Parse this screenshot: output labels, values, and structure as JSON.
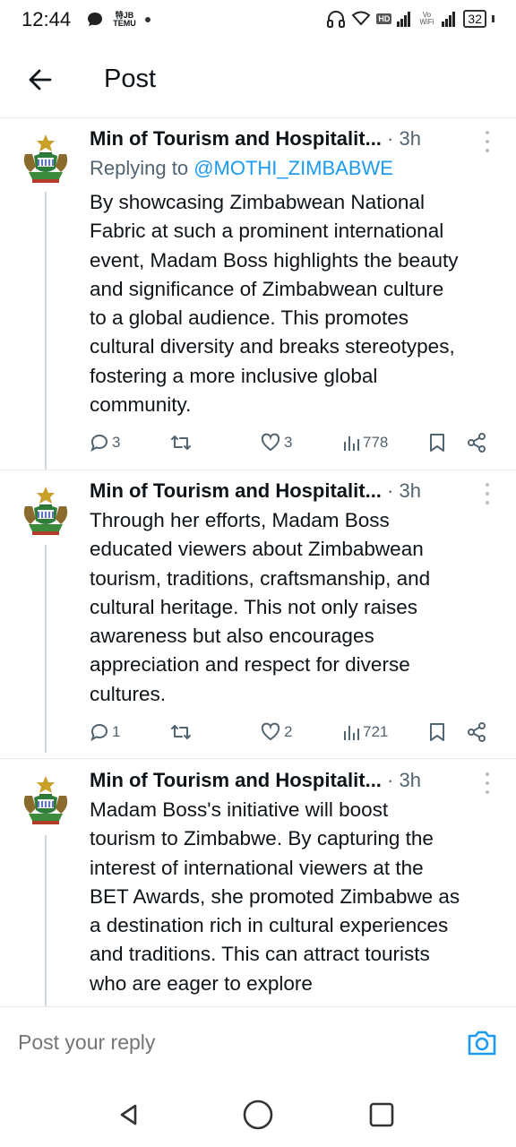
{
  "status_bar": {
    "time": "12:44",
    "temu_label": "TEMU",
    "temu_top": "特JB",
    "hd_label": "HD",
    "vowifi_label": "Vo WiFi",
    "battery_level": "32"
  },
  "header": {
    "title": "Post"
  },
  "tweets": [
    {
      "author": "Min of Tourism and Hospitalit...",
      "meta": " · 3h",
      "reply_prefix": "Replying to ",
      "reply_handle": "@MOTHI_ZIMBABWE",
      "lines": [
        "By showcasing Zimbabwean National",
        "Fabric at such a prominent international",
        "event, Madam Boss highlights the beauty",
        "and significance of Zimbabwean culture",
        "to a global audience. This promotes",
        "cultural diversity and breaks stereotypes,",
        "fostering a more inclusive global",
        "community."
      ],
      "replies": "3",
      "reposts": "",
      "likes": "3",
      "views": "778"
    },
    {
      "author": "Min of Tourism and Hospitalit...",
      "meta": " · 3h",
      "lines": [
        "Through her efforts, Madam Boss",
        "educated viewers about Zimbabwean",
        "tourism,  traditions, craftsmanship, and",
        "cultural heritage. This not only raises",
        "awareness but also encourages",
        "appreciation and respect for diverse",
        "cultures."
      ],
      "replies": "1",
      "reposts": "",
      "likes": "2",
      "views": "721"
    },
    {
      "author": "Min of Tourism and Hospitalit...",
      "meta": " · 3h",
      "lines": [
        "Madam Boss's initiative will boost",
        "tourism to Zimbabwe. By capturing the",
        "interest of international viewers at the",
        "BET Awards, she promoted Zimbabwe as",
        "a destination rich in cultural experiences",
        "and traditions. This can attract tourists",
        "who are eager to explore"
      ]
    }
  ],
  "compose": {
    "placeholder": "Post your reply"
  },
  "colors": {
    "accent": "#1d9bf0",
    "muted": "#536471",
    "text": "#0f1419"
  }
}
